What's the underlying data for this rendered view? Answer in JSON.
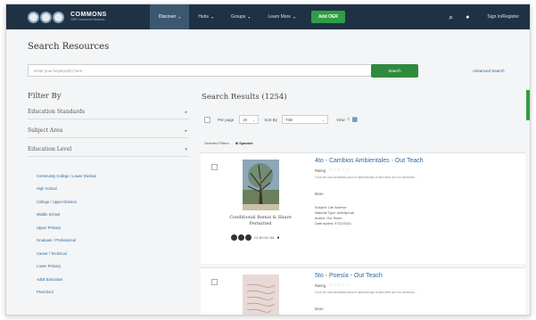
{
  "nav": {
    "logo_main": "COMMONS",
    "logo_sub": "OER Commons Network",
    "items": [
      {
        "label": "Discover",
        "active": true
      },
      {
        "label": "Hubs",
        "active": false
      },
      {
        "label": "Groups",
        "active": false
      },
      {
        "label": "Learn More",
        "active": false
      }
    ],
    "add_oer_label": "Add OER",
    "search_icon": "search-icon",
    "bell_icon": "bell-icon",
    "login_label": "Sign In/Register"
  },
  "search": {
    "title": "Search Resources",
    "placeholder": "Enter your keyword(s) here",
    "button_label": "Search",
    "advanced_label": "Advanced Search"
  },
  "filters": {
    "title": "Filter By",
    "sections": [
      {
        "label": "Education Standards"
      },
      {
        "label": "Subject Area"
      },
      {
        "label": "Education Level"
      }
    ],
    "levels": [
      "Community College / Lower Division",
      "High School",
      "College / Upper Division",
      "Middle School",
      "Upper Primary",
      "Graduate / Professional",
      "Career / Technical",
      "Lower Primary",
      "Adult Education",
      "Preschool"
    ]
  },
  "results": {
    "title": "Search Results (1254)",
    "per_page_label": "Per page",
    "per_page_value": "20",
    "sort_by_label": "Sort By",
    "sort_by_value": "Title",
    "view_label": "View",
    "selected_filters_label": "Selected Filters:",
    "selected_filter_value": "Spanish",
    "items": [
      {
        "title": "4to - Cambios Ambientales - Out Teach",
        "rating_label": "Rating",
        "stars": "☆☆☆☆☆",
        "description": "Guía de una Actividad para el aprendizaje al aire libre por los alumnos...",
        "more_label": "More",
        "subject": "Subject: Life Science",
        "material_type": "Material Type: Activity/Lab",
        "author": "Author: Out Teach",
        "date_added": "Date Added: 07/22/2021",
        "license_label": "Conditional Remix & Share Permitted",
        "license_code": "CC BY-NC-SA"
      },
      {
        "title": "5to - Poesía - Out Teach",
        "rating_label": "Rating",
        "stars": "☆☆☆☆☆",
        "description": "Guía de una Actividad para el aprendizaje al aire libre por los alumnos...",
        "more_label": "More"
      }
    ]
  },
  "colors": {
    "nav_bg": "#1f3244",
    "accent_green": "#2f9e45",
    "link_blue": "#2c6aa0"
  }
}
